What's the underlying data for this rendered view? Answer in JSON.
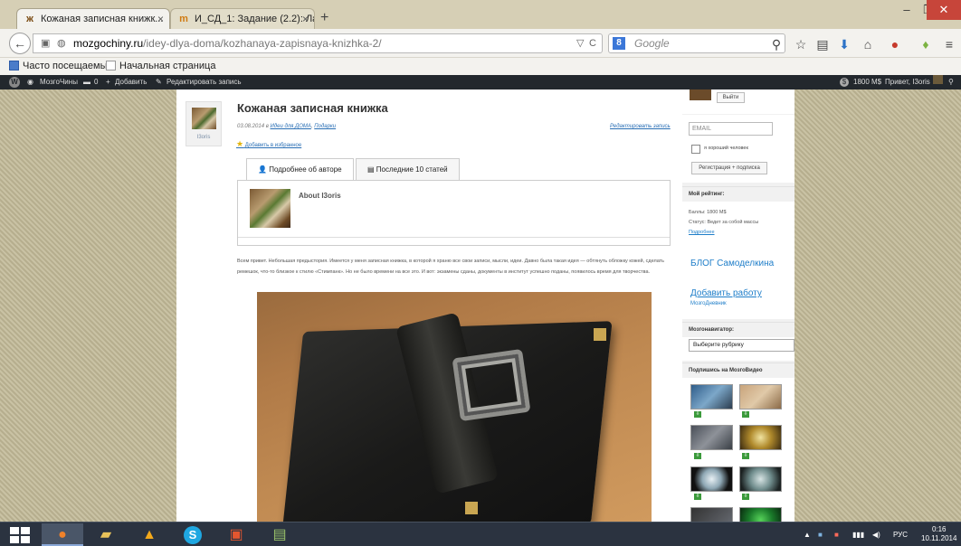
{
  "browser": {
    "tabs": [
      {
        "icon": "mozgochiny-favicon",
        "label": "Кожаная записная книжк...",
        "active": true
      },
      {
        "icon": "sd-favicon",
        "label": "И_СД_1: Задание (2.2): Ла...",
        "active": false
      }
    ],
    "new_tab": "+",
    "url_domain": "mozgochiny.ru",
    "url_path": "/idey-dlya-doma/kozhanaya-zapisnaya-knizhka-2/",
    "search_placeholder": "Google",
    "search_engine_letter": "8",
    "window_controls": {
      "minimize": "–",
      "maximize": "❐",
      "close": "✕"
    },
    "bookmarks": [
      "Часто посещаемые",
      "Начальная страница"
    ],
    "ghost_text": "с"
  },
  "wp_admin_bar": {
    "site": "МозгоЧины",
    "comments": "0",
    "add": "Добавить",
    "edit": "Редактировать запись",
    "balance": "1800 M$",
    "greeting": "Привет, I3oris"
  },
  "post": {
    "author_name": "I3oris",
    "title": "Кожаная записная книжка",
    "date": "03.08.2014 в",
    "category": "Идеи для ДОМА",
    "category2": "Подарки",
    "edit_link": "Редактировать запись",
    "favorite_link": "Добавить в избранное",
    "tabs": [
      "Подробнее об авторе",
      "Последние 10 статей"
    ],
    "about_author": "About I3oris",
    "intro": "Всем привет. Небольшая предыстория. Имеется у меня записная книжка, в которой я храню все свои записи, мысли, идеи. Давно была такая идея — обтянуть обложку кожей, сделать ремешок, что-то близкое к стилю «Стимпанк». Но не было времени на все это. И вот: экзамены сданы, документы в институт успешно поданы, появилось время для творчества."
  },
  "sidebar": {
    "logout_button": "Выйти",
    "email_placeholder": "EMAIL",
    "good_person_label": "я хороший человек",
    "register_button": "Регистрация + подписка",
    "rating_header": "Мой рейтинг:",
    "points": "Баллы: 1800 M$",
    "status": "Статус: Ведет за собой массы",
    "details_link": "Подробнее",
    "blog_link": "БЛОГ Самоделкина",
    "add_work_link": "Добавить работу",
    "add_work_sub": "МозгоДневник",
    "navigator_header": "Мозгонавигатор:",
    "rubric_select": "Выберите рубрику",
    "video_header": "Подпишись на МозгоВидео"
  },
  "taskbar": {
    "apps": [
      "windows-start",
      "firefox",
      "file-explorer",
      "aimp",
      "skype",
      "photo-viewer",
      "misc-app"
    ],
    "language": "РУС",
    "time": "0:16",
    "date": "10.11.2014"
  }
}
